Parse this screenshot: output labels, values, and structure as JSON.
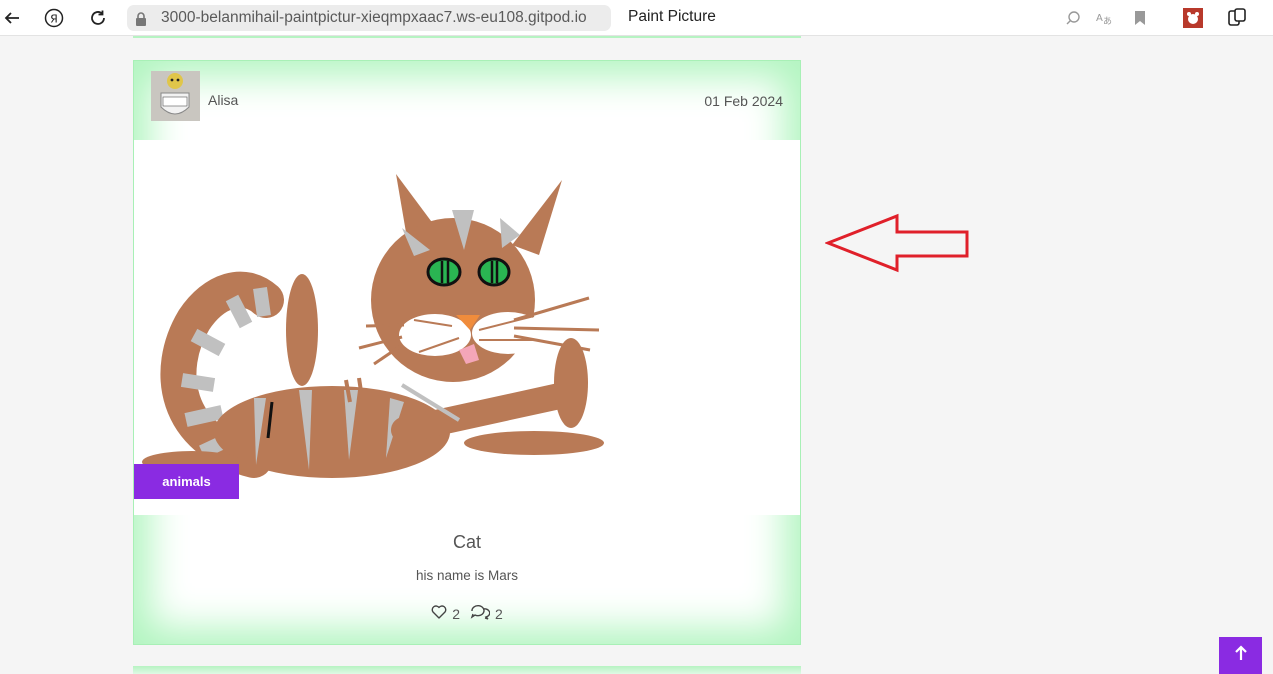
{
  "browser": {
    "url": "3000-belanmihail-paintpictur-xieqmpxaac7.ws-eu108.gitpod.io",
    "tab_title": "Paint Picture",
    "icons": [
      "back-icon",
      "yandex-icon",
      "reload-icon",
      "lock-icon",
      "search-icon",
      "translate-icon",
      "bookmark-icon",
      "extension-icon",
      "collections-icon"
    ]
  },
  "post": {
    "author": "Alisa",
    "avatar_text": "Alisa",
    "date": "01 Feb 2024",
    "tag": "animals",
    "title": "Cat",
    "description": "his name is Mars",
    "likes": "2",
    "comments": "2"
  },
  "colors": {
    "accent": "#8a2be2",
    "card_glow": "#b2f5c0",
    "cat_fur": "#b97a56",
    "cat_stripes": "#c0c0c0",
    "annotation": "#e0202a"
  }
}
